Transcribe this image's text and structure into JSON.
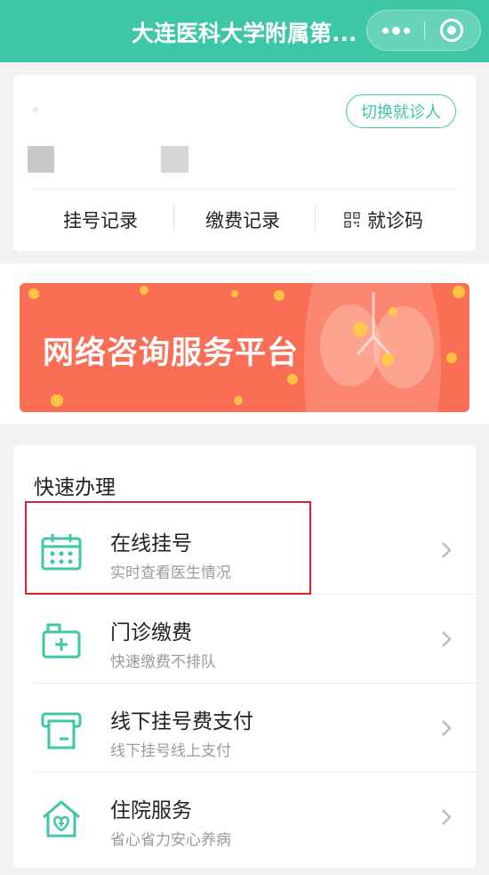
{
  "header": {
    "title": "大连医科大学附属第..."
  },
  "patient_card": {
    "switch_label": "切换就诊人",
    "links": [
      {
        "label": "挂号记录"
      },
      {
        "label": "缴费记录"
      },
      {
        "label": "就诊码",
        "icon": "qr-code-icon"
      }
    ]
  },
  "banner": {
    "text": "网络咨询服务平台",
    "color": "#fa6e55"
  },
  "quick": {
    "title": "快速办理",
    "items": [
      {
        "name": "在线挂号",
        "desc": "实时查看医生情况",
        "icon": "calendar-icon",
        "highlighted": true
      },
      {
        "name": "门诊缴费",
        "desc": "快速缴费不排队",
        "icon": "medical-box-icon"
      },
      {
        "name": "线下挂号费支付",
        "desc": "线下挂号线上支付",
        "icon": "receipt-printer-icon"
      },
      {
        "name": "住院服务",
        "desc": "省心省力安心养病",
        "icon": "hospital-heart-icon"
      }
    ]
  },
  "colors": {
    "accent": "#3dc7a6",
    "highlight_border": "#e0202a"
  }
}
